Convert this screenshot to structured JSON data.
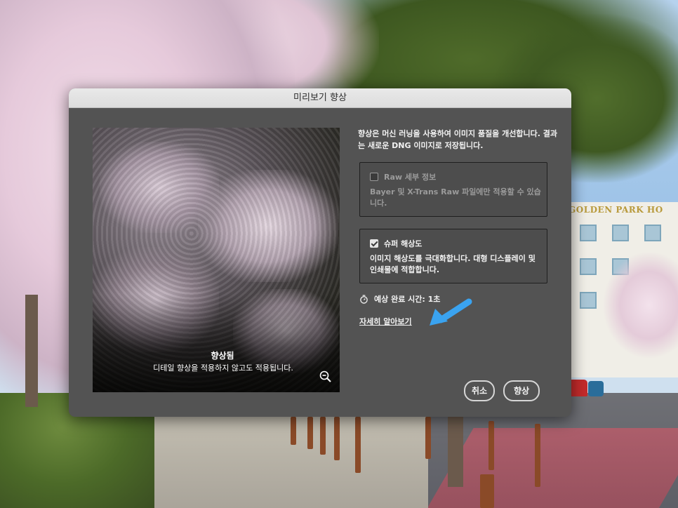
{
  "background": {
    "building_sign": "GOLDEN PARK HO"
  },
  "dialog": {
    "title": "미리보기 향상",
    "preview": {
      "label_title": "향상됨",
      "label_desc": "디테일 향상을 적용하지 않고도 적용됩니다.",
      "zoom_icon": "zoom-out-icon"
    },
    "description": "향상은 머신 러닝을 사용하여 이미지 품질을 개선합니다. 결과는 새로운 DNG 이미지로 저장됩니다.",
    "options": [
      {
        "label": "Raw 세부 정보",
        "checked": false,
        "enabled": false,
        "description": "Bayer 및 X-Trans Raw 파일에만 적용할 수 있습니다."
      },
      {
        "label": "슈퍼 해상도",
        "checked": true,
        "enabled": true,
        "description": "이미지 해상도를 극대화합니다. 대형 디스플레이 및 인쇄물에 적합합니다."
      }
    ],
    "estimated_time": "예상 완료 시간: 1초",
    "learn_more": "자세히 알아보기",
    "buttons": {
      "cancel": "취소",
      "enhance": "향상"
    },
    "annotation_arrow_color": "#3aa3f0"
  }
}
